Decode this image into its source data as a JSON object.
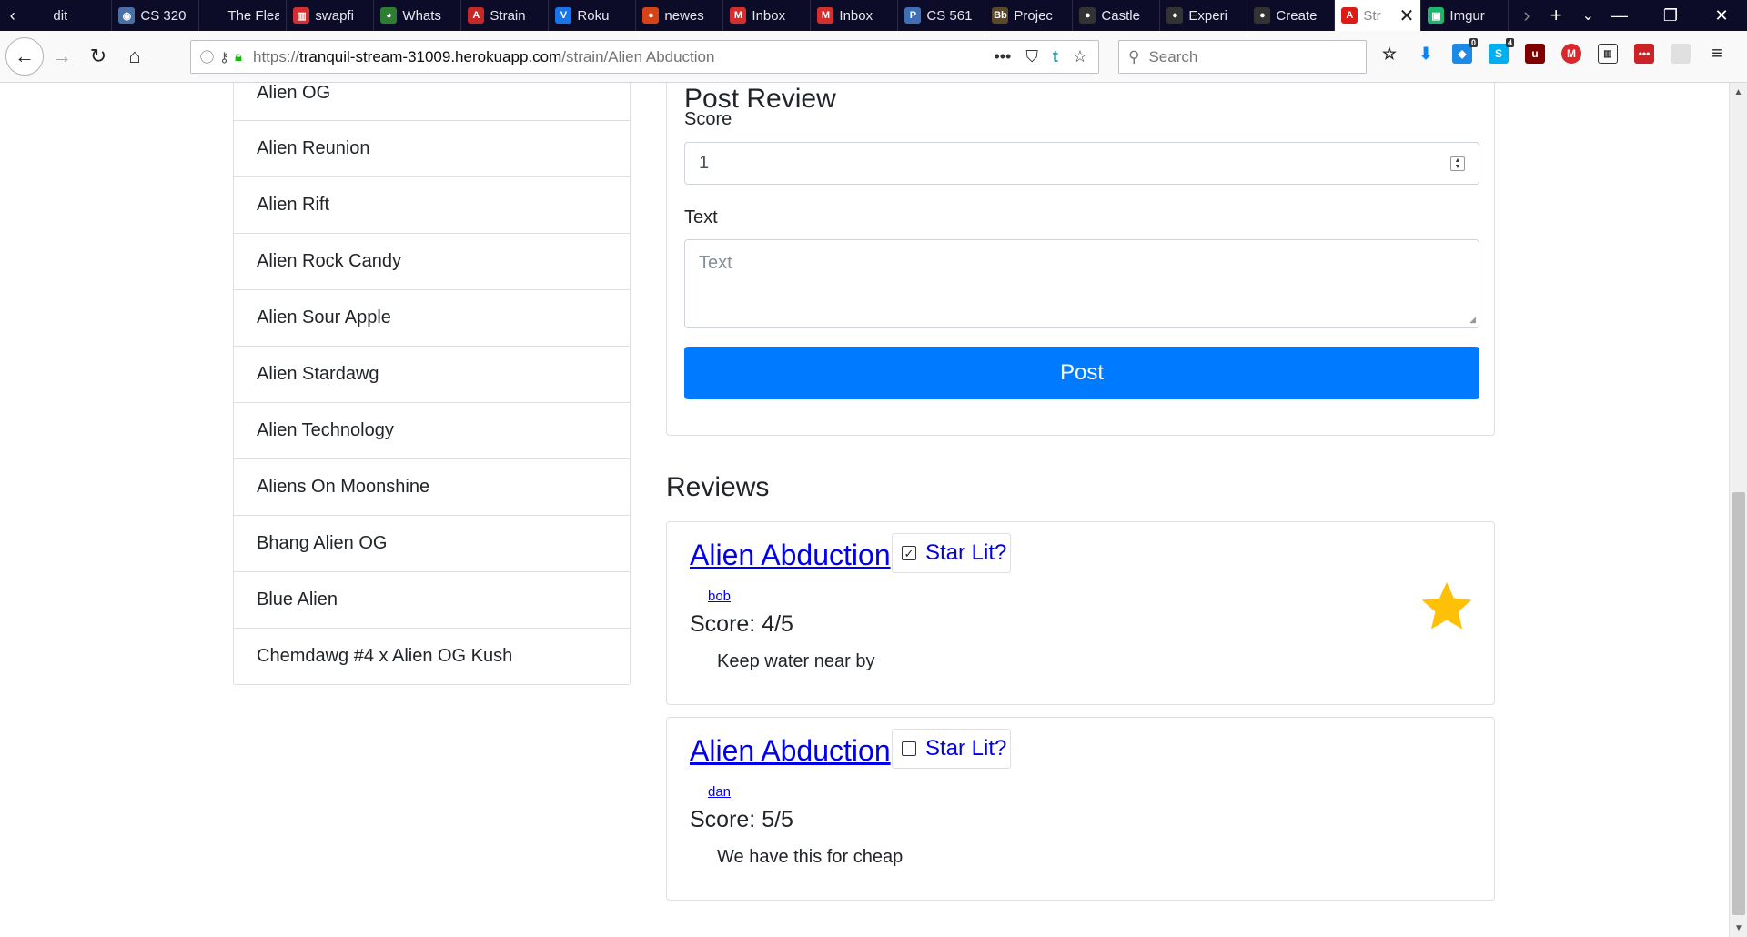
{
  "browser": {
    "tabs": [
      {
        "label": "dit",
        "favicon_color": "#0c0c28",
        "favicon_glyph": ""
      },
      {
        "label": "CS 320",
        "favicon_color": "#4a6fa5",
        "favicon_glyph": "◉"
      },
      {
        "label": "The Flea a",
        "favicon_color": "#0c0c28",
        "favicon_glyph": ""
      },
      {
        "label": "swapfi",
        "favicon_color": "#d32f2f",
        "favicon_glyph": "▥"
      },
      {
        "label": "Whats",
        "favicon_color": "#2e7d32",
        "favicon_glyph": "◕"
      },
      {
        "label": "Strain",
        "favicon_color": "#c62828",
        "favicon_glyph": "A"
      },
      {
        "label": "Roku",
        "favicon_color": "#1a73e8",
        "favicon_glyph": "V"
      },
      {
        "label": "newes",
        "favicon_color": "#d84315",
        "favicon_glyph": "●"
      },
      {
        "label": "Inbox",
        "favicon_color": "#d32f2f",
        "favicon_glyph": "M"
      },
      {
        "label": "Inbox",
        "favicon_color": "#d32f2f",
        "favicon_glyph": "M"
      },
      {
        "label": "CS 561",
        "favicon_color": "#3f6fb5",
        "favicon_glyph": "P"
      },
      {
        "label": "Projec",
        "favicon_color": "#5a4a2a",
        "favicon_glyph": "Bb"
      },
      {
        "label": "Castle",
        "favicon_color": "#333333",
        "favicon_glyph": "●"
      },
      {
        "label": "Experi",
        "favicon_color": "#333333",
        "favicon_glyph": "●"
      },
      {
        "label": "Create",
        "favicon_color": "#333333",
        "favicon_glyph": "●"
      }
    ],
    "active_tab": {
      "label": "Str",
      "favicon_color": "#dd1b16",
      "favicon_glyph": "A"
    },
    "after_tab": {
      "label": "Imgur",
      "favicon_color": "#1bb76e",
      "favicon_glyph": "▣"
    },
    "url_prefix": "https://",
    "url_host": "tranquil-stream-31009.herokuapp.com",
    "url_path": "/strain/Alien Abduction",
    "search_placeholder": "Search",
    "toolbar_badges": {
      "notifications": "0",
      "skype": "4"
    }
  },
  "strain_list": [
    "Alien OG",
    "Alien Reunion",
    "Alien Rift",
    "Alien Rock Candy",
    "Alien Sour Apple",
    "Alien Stardawg",
    "Alien Technology",
    "Aliens On Moonshine",
    "Bhang Alien OG",
    "Blue Alien",
    "Chemdawg #4 x Alien OG Kush"
  ],
  "post_review": {
    "title": "Post Review",
    "score_label": "Score",
    "score_value": "1",
    "text_label": "Text",
    "text_placeholder": "Text",
    "button_label": "Post"
  },
  "reviews_heading": "Reviews",
  "reviews": [
    {
      "title": "Alien Abduction",
      "star_label": "Star Lit?",
      "checked": true,
      "author": "bob",
      "score": "Score: 4/5",
      "text": "Keep water near by",
      "star_color": "#ffc107"
    },
    {
      "title": "Alien Abduction",
      "star_label": "Star Lit?",
      "checked": false,
      "author": "dan",
      "score": "Score: 5/5",
      "text": "We have this for cheap"
    }
  ]
}
